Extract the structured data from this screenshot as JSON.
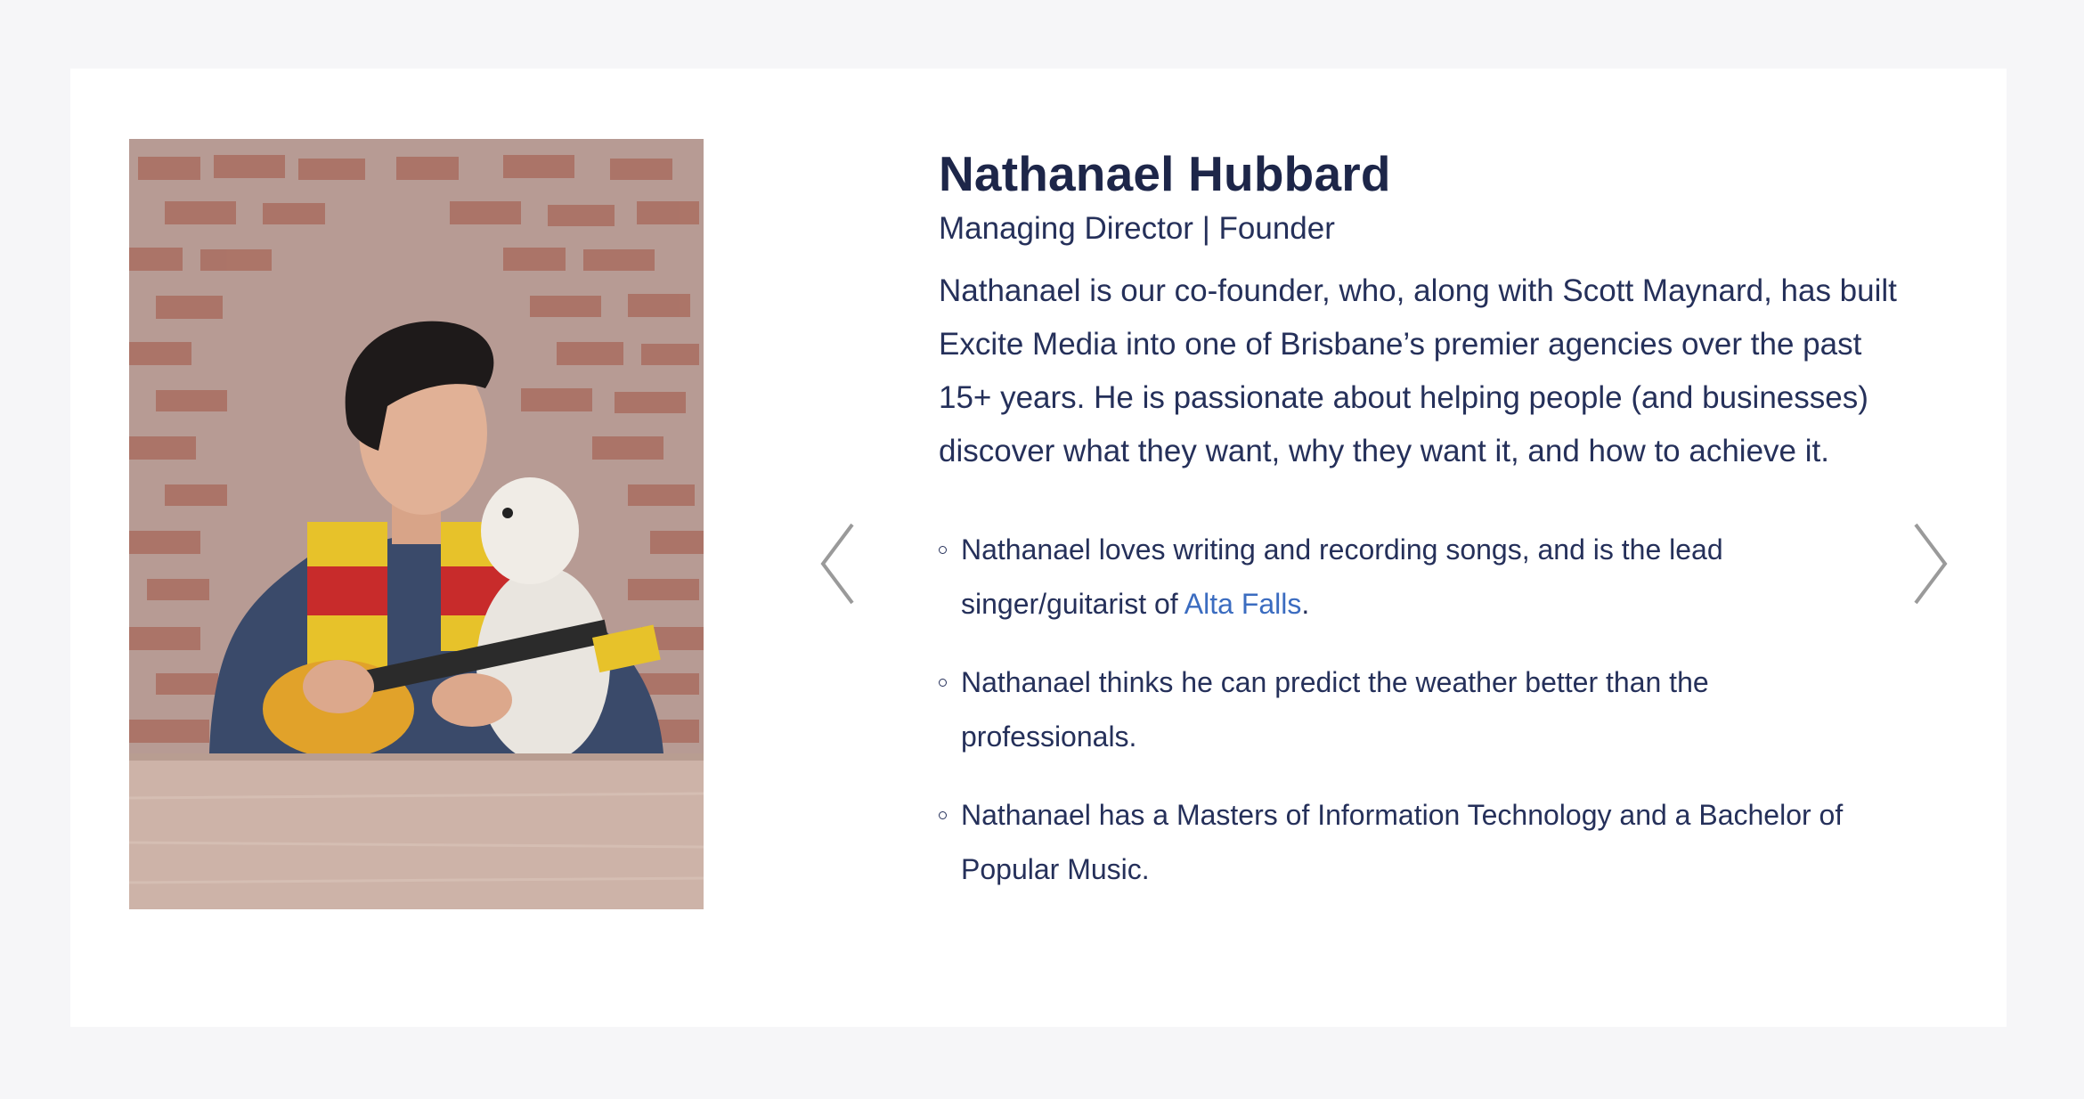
{
  "profile": {
    "name": "Nathanael Hubbard",
    "role": "Managing Director | Founder",
    "bio": "Nathanael is our co-founder, who, along with Scott Maynard, has built Excite Media into one of Brisbane’s premier agencies over the past 15+ years. He is passionate about helping people (and businesses) discover what they want, why they want it, and how to achieve it."
  },
  "facts": [
    {
      "text_before": "Nathanael loves writing and recording songs, and is the lead singer/guitarist of ",
      "link": "Alta Falls",
      "text_after": "."
    },
    {
      "text_before": "Nathanael thinks he can predict the weather better than the professionals.",
      "link": "",
      "text_after": ""
    },
    {
      "text_before": "Nathanael has a Masters of Information Technology and a Bachelor of Popular Music.",
      "link": "",
      "text_after": ""
    }
  ],
  "icons": {
    "prev": "chevron-left-icon",
    "next": "chevron-right-icon"
  },
  "colors": {
    "page_bg": "#f6f6f8",
    "card_bg": "#ffffff",
    "heading": "#1d2649",
    "body_text": "#25305a",
    "link": "#3b6cc0",
    "arrow": "#9a9a9a"
  }
}
